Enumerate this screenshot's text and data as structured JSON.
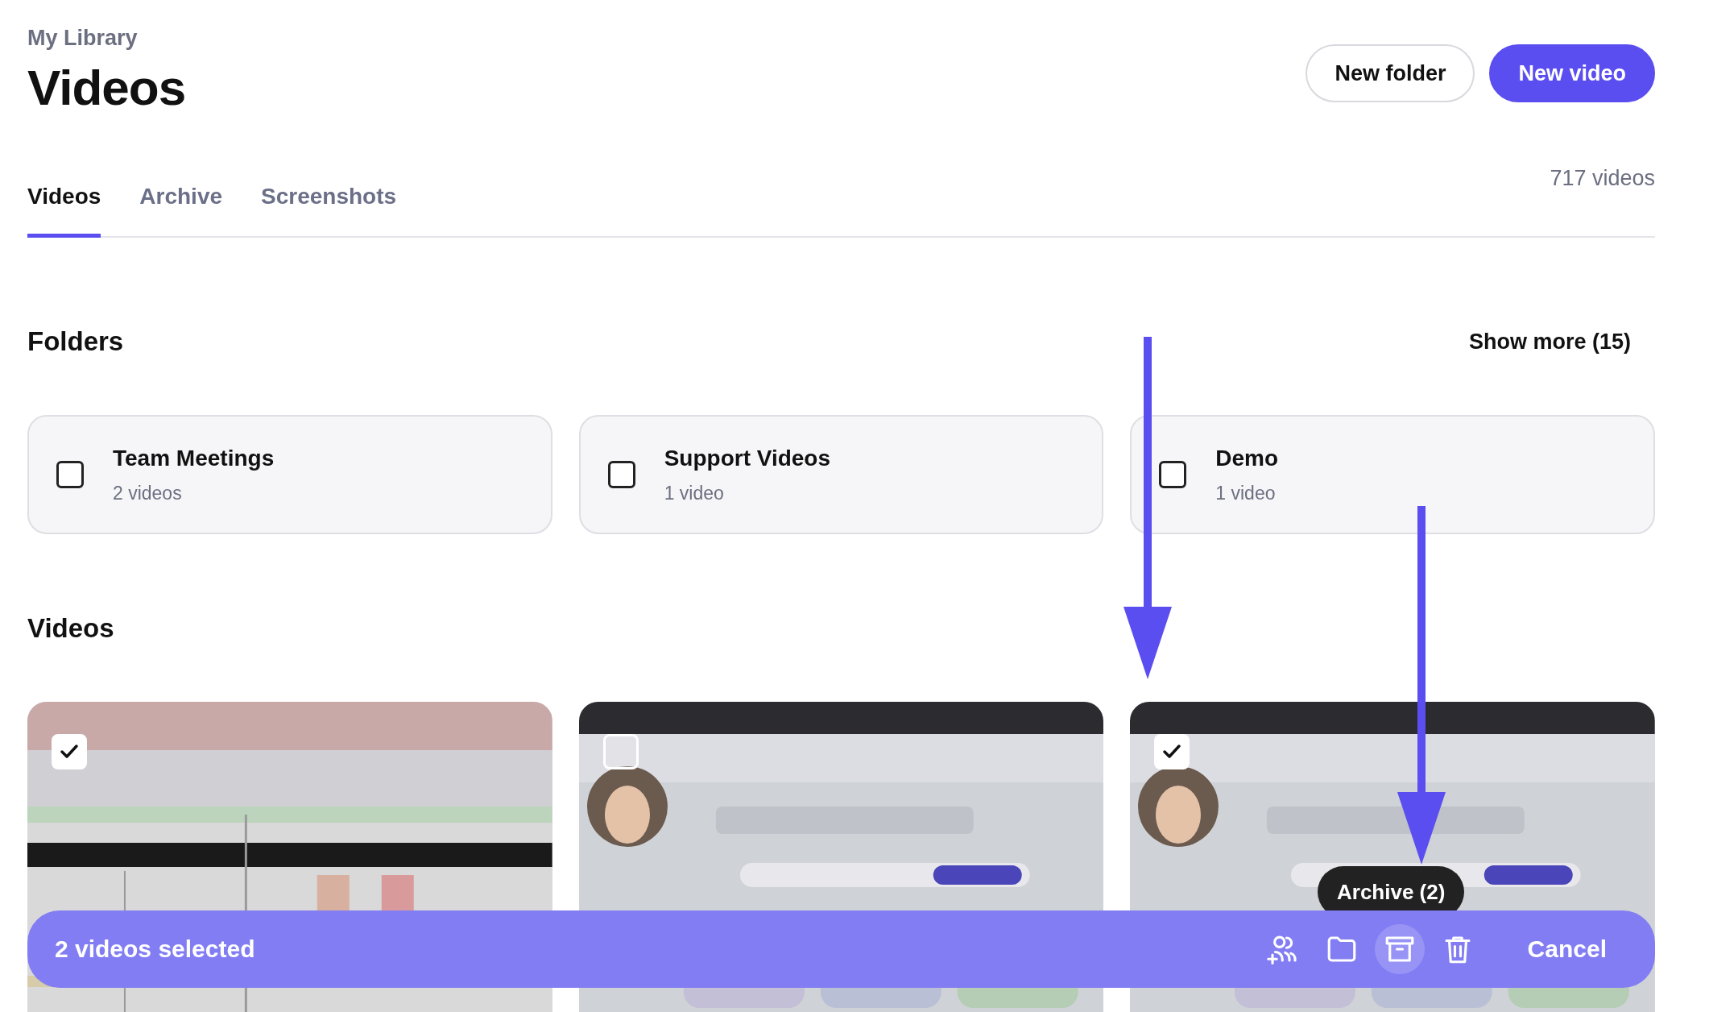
{
  "breadcrumb": "My Library",
  "title": "Videos",
  "actions": [
    {
      "label": "New folder",
      "kind": "secondary"
    },
    {
      "label": "New video",
      "kind": "primary"
    }
  ],
  "tabs": [
    {
      "label": "Videos",
      "selected": true
    },
    {
      "label": "Archive",
      "selected": false
    },
    {
      "label": "Screenshots",
      "selected": false
    }
  ],
  "video_count": "717 videos",
  "folders_section": {
    "heading": "Folders",
    "show_more": "Show more (15)"
  },
  "folders": [
    {
      "name": "Team Meetings",
      "count": "2 videos",
      "checked": false
    },
    {
      "name": "Support Videos",
      "count": "1 video",
      "checked": false
    },
    {
      "name": "Demo",
      "count": "1 video",
      "checked": false
    }
  ],
  "videos_section": {
    "heading": "Videos"
  },
  "videos": [
    {
      "kind": "picture",
      "checked": true
    },
    {
      "kind": "picture",
      "checked": false
    },
    {
      "kind": "picture",
      "checked": true
    }
  ],
  "tooltip": "Archive (2)",
  "selection_bar": {
    "label": "2 videos selected",
    "cancel": "Cancel"
  }
}
